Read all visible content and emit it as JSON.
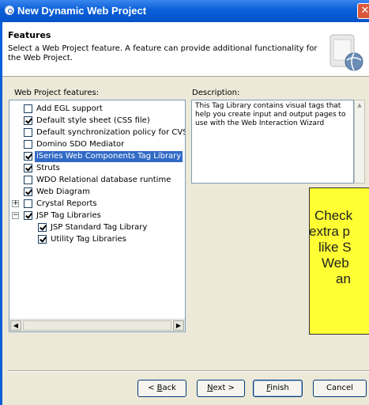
{
  "window": {
    "title": "New Dynamic Web Project",
    "close_glyph": "✕"
  },
  "header": {
    "title": "Features",
    "description": "Select a Web Project feature.  A feature can provide additional functionality for the Web Project."
  },
  "tree": {
    "label": "Web Project features:",
    "items": [
      {
        "label": "Add EGL support",
        "checked": false
      },
      {
        "label": "Default style sheet (CSS file)",
        "checked": true
      },
      {
        "label": "Default synchronization policy for CVS re",
        "checked": false
      },
      {
        "label": "Domino SDO Mediator",
        "checked": false
      },
      {
        "label": "iSeries Web Components Tag Library",
        "checked": true,
        "selected": true
      },
      {
        "label": "Struts",
        "checked": true
      },
      {
        "label": "WDO Relational database runtime",
        "checked": false
      },
      {
        "label": "Web Diagram",
        "checked": true
      },
      {
        "label": "Crystal Reports",
        "checked": false,
        "expander": "+"
      },
      {
        "label": "JSP Tag Libraries",
        "checked": true,
        "expander": "−"
      },
      {
        "label": "JSP Standard Tag Library",
        "checked": true,
        "child": true
      },
      {
        "label": "Utility Tag Libraries",
        "checked": true,
        "child": true
      }
    ]
  },
  "description_panel": {
    "label": "Description:",
    "text": "This Tag Library contains visual tags that help you create input and output pages to use with the Web Interaction Wizard"
  },
  "callout": {
    "lines": [
      "Check",
      "extra p",
      "like S",
      "Web",
      "an"
    ]
  },
  "buttons": {
    "back": {
      "mnemonic": "B",
      "rest": "ack",
      "prefix": "< "
    },
    "next": {
      "mnemonic": "N",
      "rest": "ext >",
      "prefix": ""
    },
    "finish": {
      "mnemonic": "F",
      "rest": "inish",
      "prefix": ""
    },
    "cancel": {
      "label": "Cancel"
    }
  }
}
